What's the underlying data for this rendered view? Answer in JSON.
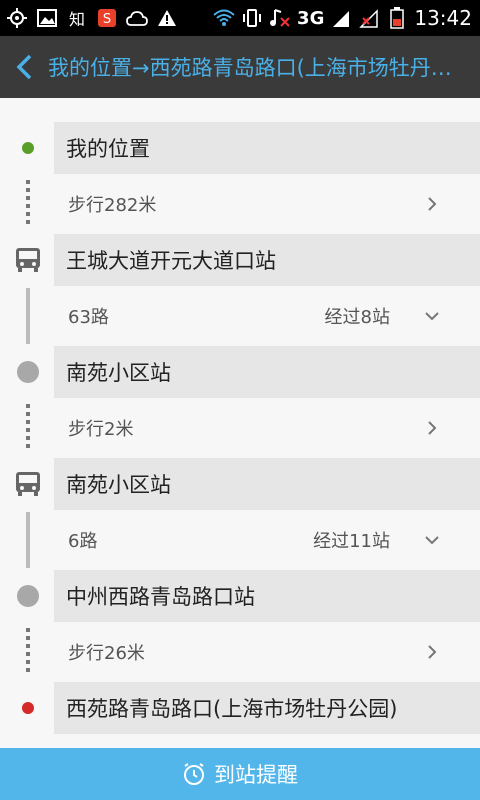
{
  "status": {
    "network": "3G",
    "time": "13:42",
    "app_label": "知"
  },
  "header": {
    "title": "我的位置→西苑路青岛路口(上海市场牡丹公园)"
  },
  "route": {
    "start": "我的位置",
    "walk1": "步行282米",
    "stop1": "王城大道开元大道口站",
    "bus1": {
      "line": "63路",
      "stops": "经过8站"
    },
    "stop2": "南苑小区站",
    "walk2": "步行2米",
    "stop3": "南苑小区站",
    "bus2": {
      "line": "6路",
      "stops": "经过11站"
    },
    "stop4": "中州西路青岛路口站",
    "walk3": "步行26米",
    "end": "西苑路青岛路口(上海市场牡丹公园)"
  },
  "footer": {
    "remind_label": "到站提醒"
  },
  "colors": {
    "accent": "#4ab0e8",
    "start_dot": "#5a9e2a",
    "end_dot": "#d42a2a",
    "bottom_bar": "#52b6ea"
  }
}
